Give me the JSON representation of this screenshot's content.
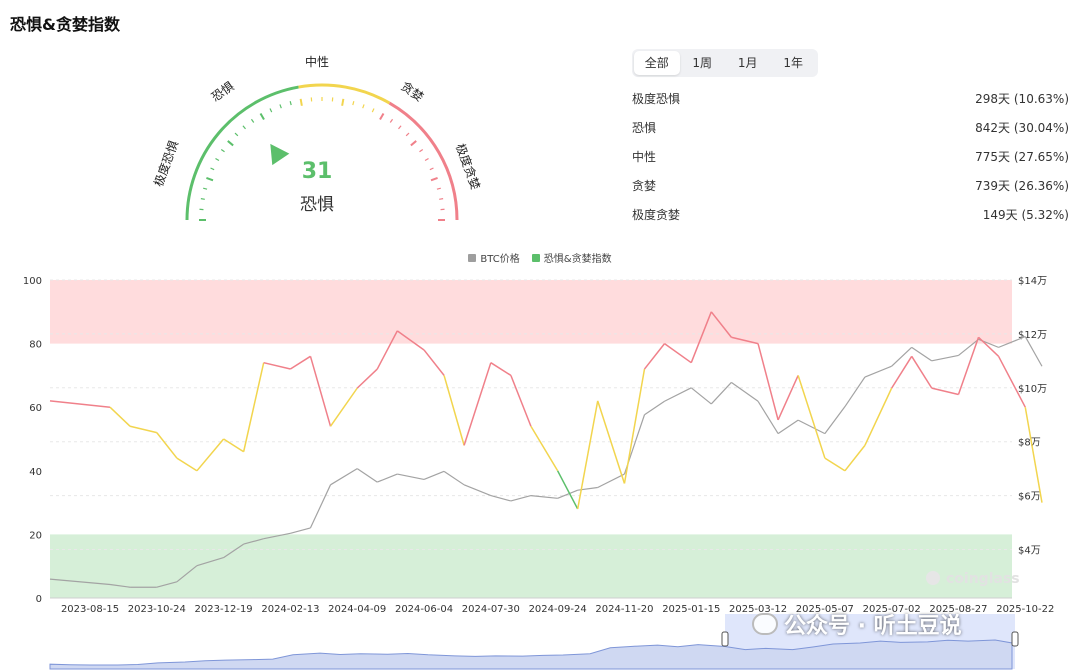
{
  "page": {
    "title": "恐惧&贪婪指数"
  },
  "gauge": {
    "value": "31",
    "value_num": 31,
    "status": "恐惧",
    "labels": {
      "extreme_fear": "极度恐惧",
      "fear": "恐惧",
      "neutral": "中性",
      "greed": "贪婪",
      "extreme_greed": "极度贪婪"
    },
    "colors": {
      "fear": "#5cbf6b",
      "neutral": "#f2d54e",
      "greed": "#f0808a",
      "needle": "#5cbf6b"
    }
  },
  "tabs": [
    {
      "label": "全部",
      "active": true
    },
    {
      "label": "1周",
      "active": false
    },
    {
      "label": "1月",
      "active": false
    },
    {
      "label": "1年",
      "active": false
    }
  ],
  "stats": [
    {
      "label": "极度恐惧",
      "value": "298天 (10.63%)"
    },
    {
      "label": "恐惧",
      "value": "842天 (30.04%)"
    },
    {
      "label": "中性",
      "value": "775天 (27.65%)"
    },
    {
      "label": "贪婪",
      "value": "739天 (26.36%)"
    },
    {
      "label": "极度贪婪",
      "value": "149天 (5.32%)"
    }
  ],
  "chart_data": {
    "type": "line",
    "title": "",
    "legend": [
      {
        "name": "BTC价格",
        "color": "#9e9e9e"
      },
      {
        "name": "恐惧&贪婪指数",
        "color": "#5cbf6b"
      }
    ],
    "x_ticks": [
      "2023-08-15",
      "2023-10-24",
      "2023-12-19",
      "2024-02-13",
      "2024-04-09",
      "2024-06-04",
      "2024-07-30",
      "2024-09-24",
      "2024-11-20",
      "2025-01-15",
      "2025-03-12",
      "2025-05-07",
      "2025-07-02",
      "2025-08-27",
      "2025-10-22"
    ],
    "y_left_ticks": [
      "0",
      "20",
      "40",
      "60",
      "80",
      "100"
    ],
    "y_left_range": [
      0,
      100
    ],
    "y_right_ticks": [
      "$4万",
      "$6万",
      "$8万",
      "$10万",
      "$12万",
      "$14万"
    ],
    "y_right_values": [
      4,
      6,
      8,
      10,
      12,
      14
    ],
    "y_right_range": [
      2.2,
      14
    ],
    "bands": [
      {
        "from": 80,
        "to": 100,
        "color": "#ffdcdd"
      },
      {
        "from": 0,
        "to": 20,
        "color": "#d6efd8"
      }
    ],
    "index_color_rules": {
      "below": 40,
      "above": 60,
      "low_color": "#5cbf6b",
      "mid_color": "#f2d54e",
      "high_color": "#f0808a"
    },
    "series": [
      {
        "name": "恐惧&贪婪指数",
        "x": [
          0,
          0.3,
          0.6,
          1,
          1.3,
          1.6,
          2,
          2.3,
          2.6,
          3,
          3.3,
          3.6,
          4,
          4.3,
          4.6,
          5,
          5.3,
          5.6,
          6,
          6.3,
          6.6,
          7,
          7.3,
          7.6,
          8,
          8.3,
          8.6,
          9,
          9.3,
          9.6,
          10,
          10.3,
          10.6,
          11,
          11.3,
          11.6,
          12,
          12.3,
          12.6,
          13,
          13.3,
          13.6,
          14,
          14.25
        ],
        "values": [
          62,
          60,
          54,
          52,
          44,
          40,
          50,
          46,
          74,
          72,
          76,
          54,
          66,
          72,
          84,
          78,
          70,
          48,
          74,
          70,
          54,
          40,
          28,
          62,
          36,
          72,
          80,
          74,
          90,
          82,
          80,
          56,
          70,
          44,
          40,
          48,
          66,
          76,
          66,
          64,
          82,
          76,
          60,
          30
        ]
      },
      {
        "name": "BTC价格",
        "x": [
          0,
          0.3,
          0.6,
          1,
          1.3,
          1.6,
          2,
          2.3,
          2.6,
          3,
          3.3,
          3.6,
          4,
          4.3,
          4.6,
          5,
          5.3,
          5.6,
          6,
          6.3,
          6.6,
          7,
          7.3,
          7.6,
          8,
          8.3,
          8.6,
          9,
          9.3,
          9.6,
          10,
          10.3,
          10.6,
          11,
          11.3,
          11.6,
          12,
          12.3,
          12.6,
          13,
          13.3,
          13.6,
          14,
          14.25
        ],
        "values": [
          2.9,
          2.7,
          2.6,
          2.6,
          2.8,
          3.4,
          3.7,
          4.2,
          4.4,
          4.6,
          4.8,
          6.4,
          7.0,
          6.5,
          6.8,
          6.6,
          6.9,
          6.4,
          6.0,
          5.8,
          6.0,
          5.9,
          6.2,
          6.3,
          6.8,
          9.0,
          9.5,
          10.0,
          9.4,
          10.2,
          9.5,
          8.3,
          8.8,
          8.3,
          9.3,
          10.4,
          10.8,
          11.5,
          11.0,
          11.2,
          11.8,
          11.5,
          11.9,
          10.8
        ]
      }
    ]
  },
  "watermark": {
    "text": "公众号 · 听土豆说"
  }
}
